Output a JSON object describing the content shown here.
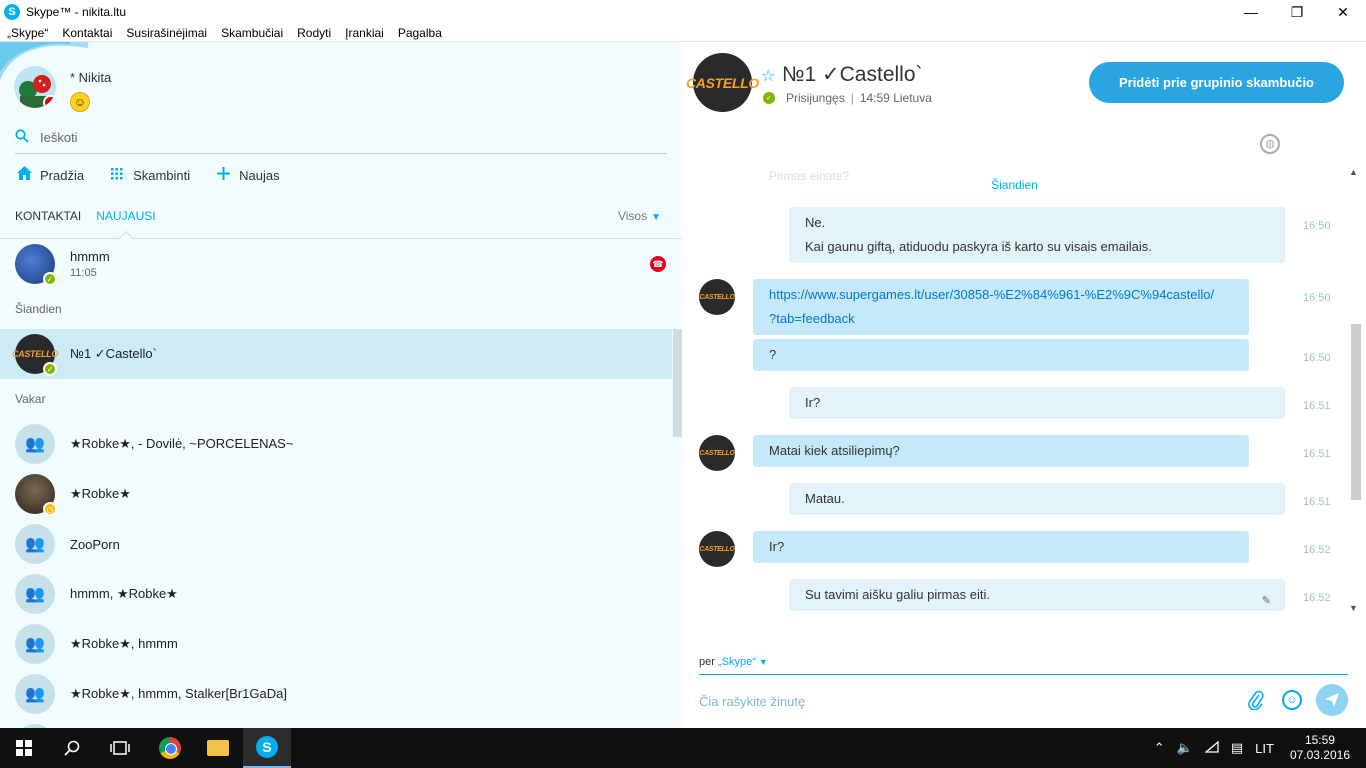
{
  "window": {
    "title": "Skype™ - nikita.ltu",
    "app_icon": "S",
    "minimize": "—",
    "restore": "❐",
    "close": "✕"
  },
  "menu": [
    "„Skype“",
    "Kontaktai",
    "Susirašinėjimai",
    "Skambučiai",
    "Rodyti",
    "Įrankiai",
    "Pagalba"
  ],
  "profile": {
    "name": "* Nikita",
    "mood_icon": "☺"
  },
  "search": {
    "placeholder": "Ieškoti"
  },
  "nav": {
    "home": "Pradžia",
    "call": "Skambinti",
    "new": "Naujas"
  },
  "tabs": {
    "contacts": "KONTAKTAI",
    "recent": "NAUJAUSI",
    "filter": "Visos"
  },
  "recent": {
    "top_item": {
      "name": "hmmm",
      "time": "11:05"
    },
    "section_today": "Šiandien",
    "today_item": {
      "name": "№1 ✓Castello`"
    },
    "section_yesterday": "Vakar",
    "yesterday_items": [
      {
        "name": "★Robke★, - Dovilė, ~PORCELENAS~"
      },
      {
        "name": "★Robke★"
      },
      {
        "name": "ZooPorn"
      },
      {
        "name": "hmmm, ★Robke★"
      },
      {
        "name": "★Robke★, hmmm"
      },
      {
        "name": "★Robke★, hmmm, Stalker[Br1GaDa]"
      }
    ],
    "avatar_text": "CASTELLO"
  },
  "conversation": {
    "name": "№1 ✓Castello`",
    "status": "Prisijungęs",
    "local_time": "14:59 Lietuva",
    "call_button": "Pridėti prie grupinio skambučio",
    "faded_text": "Pirmas einate?",
    "day_divider": "Šiandien",
    "messages": [
      {
        "dir": "out",
        "lines": [
          "Ne.",
          "Kai gaunu giftą, atiduodu paskyra iš karto su visais emailais."
        ],
        "time": "16:50"
      },
      {
        "dir": "in",
        "lines": [
          "https://www.supergames.lt/user/30858-%E2%84%961-%E2%9C%94castello/",
          "?tab=feedback"
        ],
        "time": "16:50"
      },
      {
        "dir": "in",
        "lines": [
          "?"
        ],
        "time": "16:50"
      },
      {
        "dir": "out",
        "lines": [
          "Ir?"
        ],
        "time": "16:51"
      },
      {
        "dir": "in",
        "lines": [
          "Matai kiek atsiliepimų?"
        ],
        "time": "16:51"
      },
      {
        "dir": "out",
        "lines": [
          "Matau."
        ],
        "time": "16:51"
      },
      {
        "dir": "in",
        "lines": [
          "Ir?"
        ],
        "time": "16:52"
      },
      {
        "dir": "out",
        "lines": [
          "Su tavimi aišku galiu pirmas eiti."
        ],
        "time": "16:52"
      }
    ],
    "via_label": "per",
    "via_value": "„Skype“",
    "composer_placeholder": "Čia rašykite žinutę"
  },
  "taskbar": {
    "language": "LIT",
    "time": "15:59",
    "date": "07.03.2016"
  },
  "colors": {
    "accent": "#00aff0",
    "online": "#7fba00",
    "away": "#ffb900",
    "dnd": "#e60000"
  }
}
